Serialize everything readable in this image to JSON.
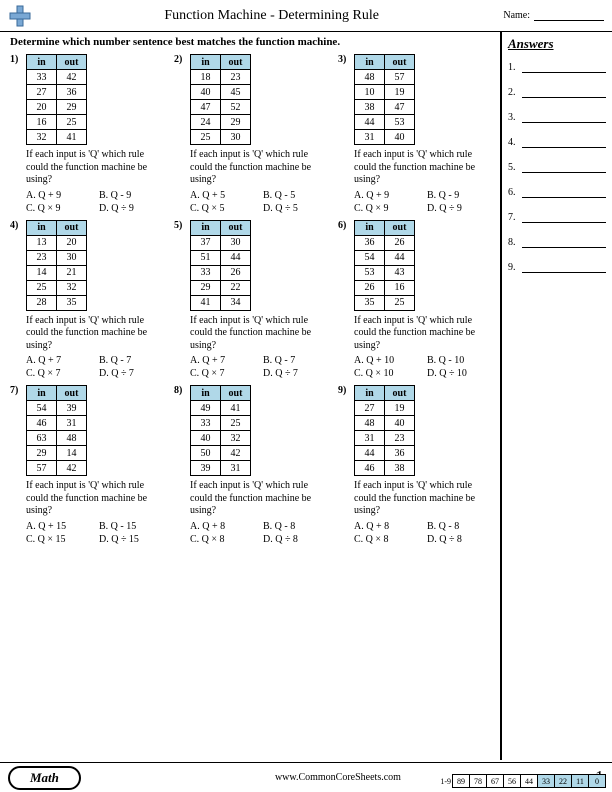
{
  "header": {
    "title": "Function Machine - Determining Rule",
    "name_label": "Name:"
  },
  "instruction": "Determine which number sentence best matches the function machine.",
  "table_headers": {
    "in": "in",
    "out": "out"
  },
  "question_text": "If each input is 'Q' which rule could the function machine be using?",
  "problems": [
    {
      "num": "1)",
      "rows": [
        [
          "33",
          "42"
        ],
        [
          "27",
          "36"
        ],
        [
          "20",
          "29"
        ],
        [
          "16",
          "25"
        ],
        [
          "32",
          "41"
        ]
      ],
      "choices": [
        "A. Q + 9",
        "B. Q - 9",
        "C. Q × 9",
        "D. Q ÷ 9"
      ]
    },
    {
      "num": "2)",
      "rows": [
        [
          "18",
          "23"
        ],
        [
          "40",
          "45"
        ],
        [
          "47",
          "52"
        ],
        [
          "24",
          "29"
        ],
        [
          "25",
          "30"
        ]
      ],
      "choices": [
        "A. Q + 5",
        "B. Q - 5",
        "C. Q × 5",
        "D. Q ÷ 5"
      ]
    },
    {
      "num": "3)",
      "rows": [
        [
          "48",
          "57"
        ],
        [
          "10",
          "19"
        ],
        [
          "38",
          "47"
        ],
        [
          "44",
          "53"
        ],
        [
          "31",
          "40"
        ]
      ],
      "choices": [
        "A. Q + 9",
        "B. Q - 9",
        "C. Q × 9",
        "D. Q ÷ 9"
      ]
    },
    {
      "num": "4)",
      "rows": [
        [
          "13",
          "20"
        ],
        [
          "23",
          "30"
        ],
        [
          "14",
          "21"
        ],
        [
          "25",
          "32"
        ],
        [
          "28",
          "35"
        ]
      ],
      "choices": [
        "A. Q + 7",
        "B. Q - 7",
        "C. Q × 7",
        "D. Q ÷ 7"
      ]
    },
    {
      "num": "5)",
      "rows": [
        [
          "37",
          "30"
        ],
        [
          "51",
          "44"
        ],
        [
          "33",
          "26"
        ],
        [
          "29",
          "22"
        ],
        [
          "41",
          "34"
        ]
      ],
      "choices": [
        "A. Q + 7",
        "B. Q - 7",
        "C. Q × 7",
        "D. Q ÷ 7"
      ]
    },
    {
      "num": "6)",
      "rows": [
        [
          "36",
          "26"
        ],
        [
          "54",
          "44"
        ],
        [
          "53",
          "43"
        ],
        [
          "26",
          "16"
        ],
        [
          "35",
          "25"
        ]
      ],
      "choices": [
        "A. Q + 10",
        "B. Q - 10",
        "C. Q × 10",
        "D. Q ÷ 10"
      ]
    },
    {
      "num": "7)",
      "rows": [
        [
          "54",
          "39"
        ],
        [
          "46",
          "31"
        ],
        [
          "63",
          "48"
        ],
        [
          "29",
          "14"
        ],
        [
          "57",
          "42"
        ]
      ],
      "choices": [
        "A. Q + 15",
        "B. Q - 15",
        "C. Q × 15",
        "D. Q ÷ 15"
      ]
    },
    {
      "num": "8)",
      "rows": [
        [
          "49",
          "41"
        ],
        [
          "33",
          "25"
        ],
        [
          "40",
          "32"
        ],
        [
          "50",
          "42"
        ],
        [
          "39",
          "31"
        ]
      ],
      "choices": [
        "A. Q + 8",
        "B. Q - 8",
        "C. Q × 8",
        "D. Q ÷ 8"
      ]
    },
    {
      "num": "9)",
      "rows": [
        [
          "27",
          "19"
        ],
        [
          "48",
          "40"
        ],
        [
          "31",
          "23"
        ],
        [
          "44",
          "36"
        ],
        [
          "46",
          "38"
        ]
      ],
      "choices": [
        "A. Q + 8",
        "B. Q - 8",
        "C. Q × 8",
        "D. Q ÷ 8"
      ]
    }
  ],
  "answers": {
    "title": "Answers",
    "count": 9
  },
  "footer": {
    "subject": "Math",
    "url": "www.CommonCoreSheets.com",
    "page": "1"
  },
  "score": {
    "label": "1-9",
    "cells": [
      "89",
      "78",
      "67",
      "56",
      "44",
      "33",
      "22",
      "11",
      "0"
    ]
  },
  "chart_data": {
    "type": "table",
    "title": "Function Machine - Determining Rule",
    "description": "Nine in/out function tables with multiple-choice rule options",
    "problems": [
      {
        "id": 1,
        "in": [
          33,
          27,
          20,
          16,
          32
        ],
        "out": [
          42,
          36,
          29,
          25,
          41
        ],
        "options": [
          "Q+9",
          "Q-9",
          "Q×9",
          "Q÷9"
        ]
      },
      {
        "id": 2,
        "in": [
          18,
          40,
          47,
          24,
          25
        ],
        "out": [
          23,
          45,
          52,
          29,
          30
        ],
        "options": [
          "Q+5",
          "Q-5",
          "Q×5",
          "Q÷5"
        ]
      },
      {
        "id": 3,
        "in": [
          48,
          10,
          38,
          44,
          31
        ],
        "out": [
          57,
          19,
          47,
          53,
          40
        ],
        "options": [
          "Q+9",
          "Q-9",
          "Q×9",
          "Q÷9"
        ]
      },
      {
        "id": 4,
        "in": [
          13,
          23,
          14,
          25,
          28
        ],
        "out": [
          20,
          30,
          21,
          32,
          35
        ],
        "options": [
          "Q+7",
          "Q-7",
          "Q×7",
          "Q÷7"
        ]
      },
      {
        "id": 5,
        "in": [
          37,
          51,
          33,
          29,
          41
        ],
        "out": [
          30,
          44,
          26,
          22,
          34
        ],
        "options": [
          "Q+7",
          "Q-7",
          "Q×7",
          "Q÷7"
        ]
      },
      {
        "id": 6,
        "in": [
          36,
          54,
          53,
          26,
          35
        ],
        "out": [
          26,
          44,
          43,
          16,
          25
        ],
        "options": [
          "Q+10",
          "Q-10",
          "Q×10",
          "Q÷10"
        ]
      },
      {
        "id": 7,
        "in": [
          54,
          46,
          63,
          29,
          57
        ],
        "out": [
          39,
          31,
          48,
          14,
          42
        ],
        "options": [
          "Q+15",
          "Q-15",
          "Q×15",
          "Q÷15"
        ]
      },
      {
        "id": 8,
        "in": [
          49,
          33,
          40,
          50,
          39
        ],
        "out": [
          41,
          25,
          32,
          42,
          31
        ],
        "options": [
          "Q+8",
          "Q-8",
          "Q×8",
          "Q÷8"
        ]
      },
      {
        "id": 9,
        "in": [
          27,
          48,
          31,
          44,
          46
        ],
        "out": [
          19,
          40,
          23,
          36,
          38
        ],
        "options": [
          "Q+8",
          "Q-8",
          "Q×8",
          "Q÷8"
        ]
      }
    ],
    "score_scale": {
      "range": "1-9",
      "percentages": [
        89,
        78,
        67,
        56,
        44,
        33,
        22,
        11,
        0
      ]
    }
  }
}
